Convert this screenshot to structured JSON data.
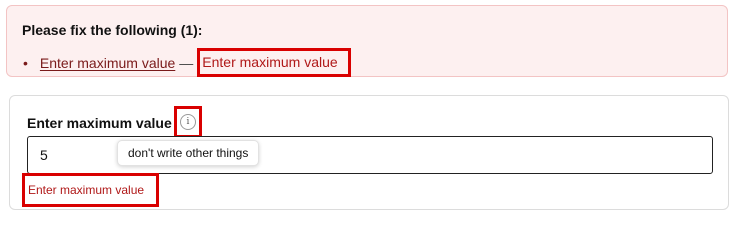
{
  "error_summary": {
    "title": "Please fix the following (1):",
    "items": [
      {
        "bullet": "•",
        "link_text": "Enter maximum value",
        "separator": "—",
        "message": "Enter maximum value"
      }
    ]
  },
  "field": {
    "label": "Enter maximum value",
    "info_icon_glyph": "i",
    "info_icon": "info-icon",
    "value": "5",
    "tooltip": "don't write other things",
    "error_message": "Enter maximum value"
  },
  "colors": {
    "error_text": "#b01818",
    "highlight_border": "#d90000",
    "summary_background": "#fdf0f0"
  }
}
